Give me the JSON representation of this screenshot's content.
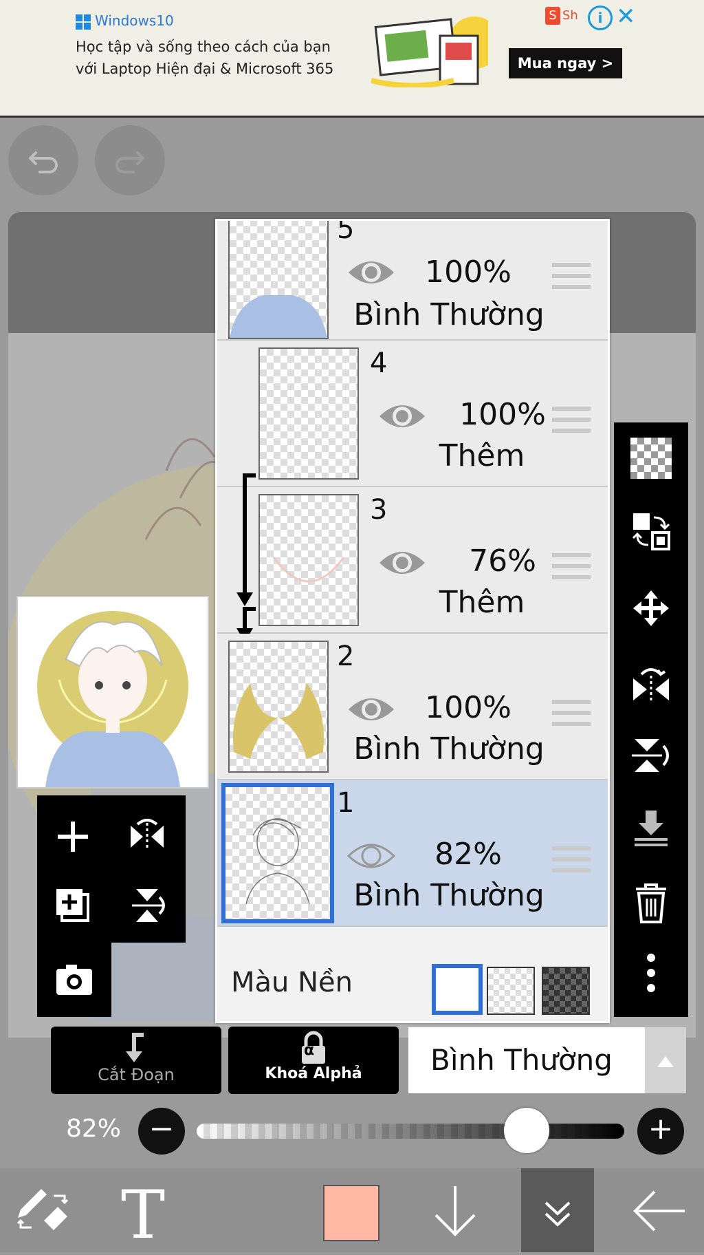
{
  "ad": {
    "brand": "Windows10",
    "line1": "Học tập và sống theo cách của bạn",
    "line2": "với Laptop Hiện đại & Microsoft 365",
    "cta": "Mua ngay >",
    "shop_label": "Sh",
    "info_glyph": "i",
    "close_glyph": "✕"
  },
  "toolbar_top": {
    "undo_icon": "undo-icon",
    "redo_icon": "redo-icon"
  },
  "layers": [
    {
      "number": "5",
      "opacity": "100%",
      "blend": "Bình Thường",
      "visible": true,
      "clipped": false,
      "selected": false
    },
    {
      "number": "4",
      "opacity": "100%",
      "blend": "Thêm",
      "visible": true,
      "clipped": true,
      "selected": false
    },
    {
      "number": "3",
      "opacity": "76%",
      "blend": "Thêm",
      "visible": true,
      "clipped": true,
      "selected": false
    },
    {
      "number": "2",
      "opacity": "100%",
      "blend": "Bình Thường",
      "visible": true,
      "clipped": false,
      "selected": false
    },
    {
      "number": "1",
      "opacity": "82%",
      "blend": "Bình Thường",
      "visible": true,
      "clipped": false,
      "selected": true
    }
  ],
  "background": {
    "label": "Màu Nền",
    "options": [
      "white",
      "transparent",
      "dark-checker"
    ],
    "selected": "white"
  },
  "controls": {
    "clipping_label": "Cắt Đoạn",
    "alpha_lock_label": "Khoá Alphả",
    "alpha_glyph": "α",
    "blend_mode": "Bình Thường",
    "opacity_label": "82%",
    "opacity_value": 0.82,
    "minus": "−",
    "plus": "+"
  },
  "bottom_bar": {
    "text_tool": "T",
    "current_color": "#ffb9a5"
  },
  "colors": {
    "accent": "#2f6fd6",
    "selected_layer": "#cad6ea",
    "panel": "#ebebeb"
  }
}
